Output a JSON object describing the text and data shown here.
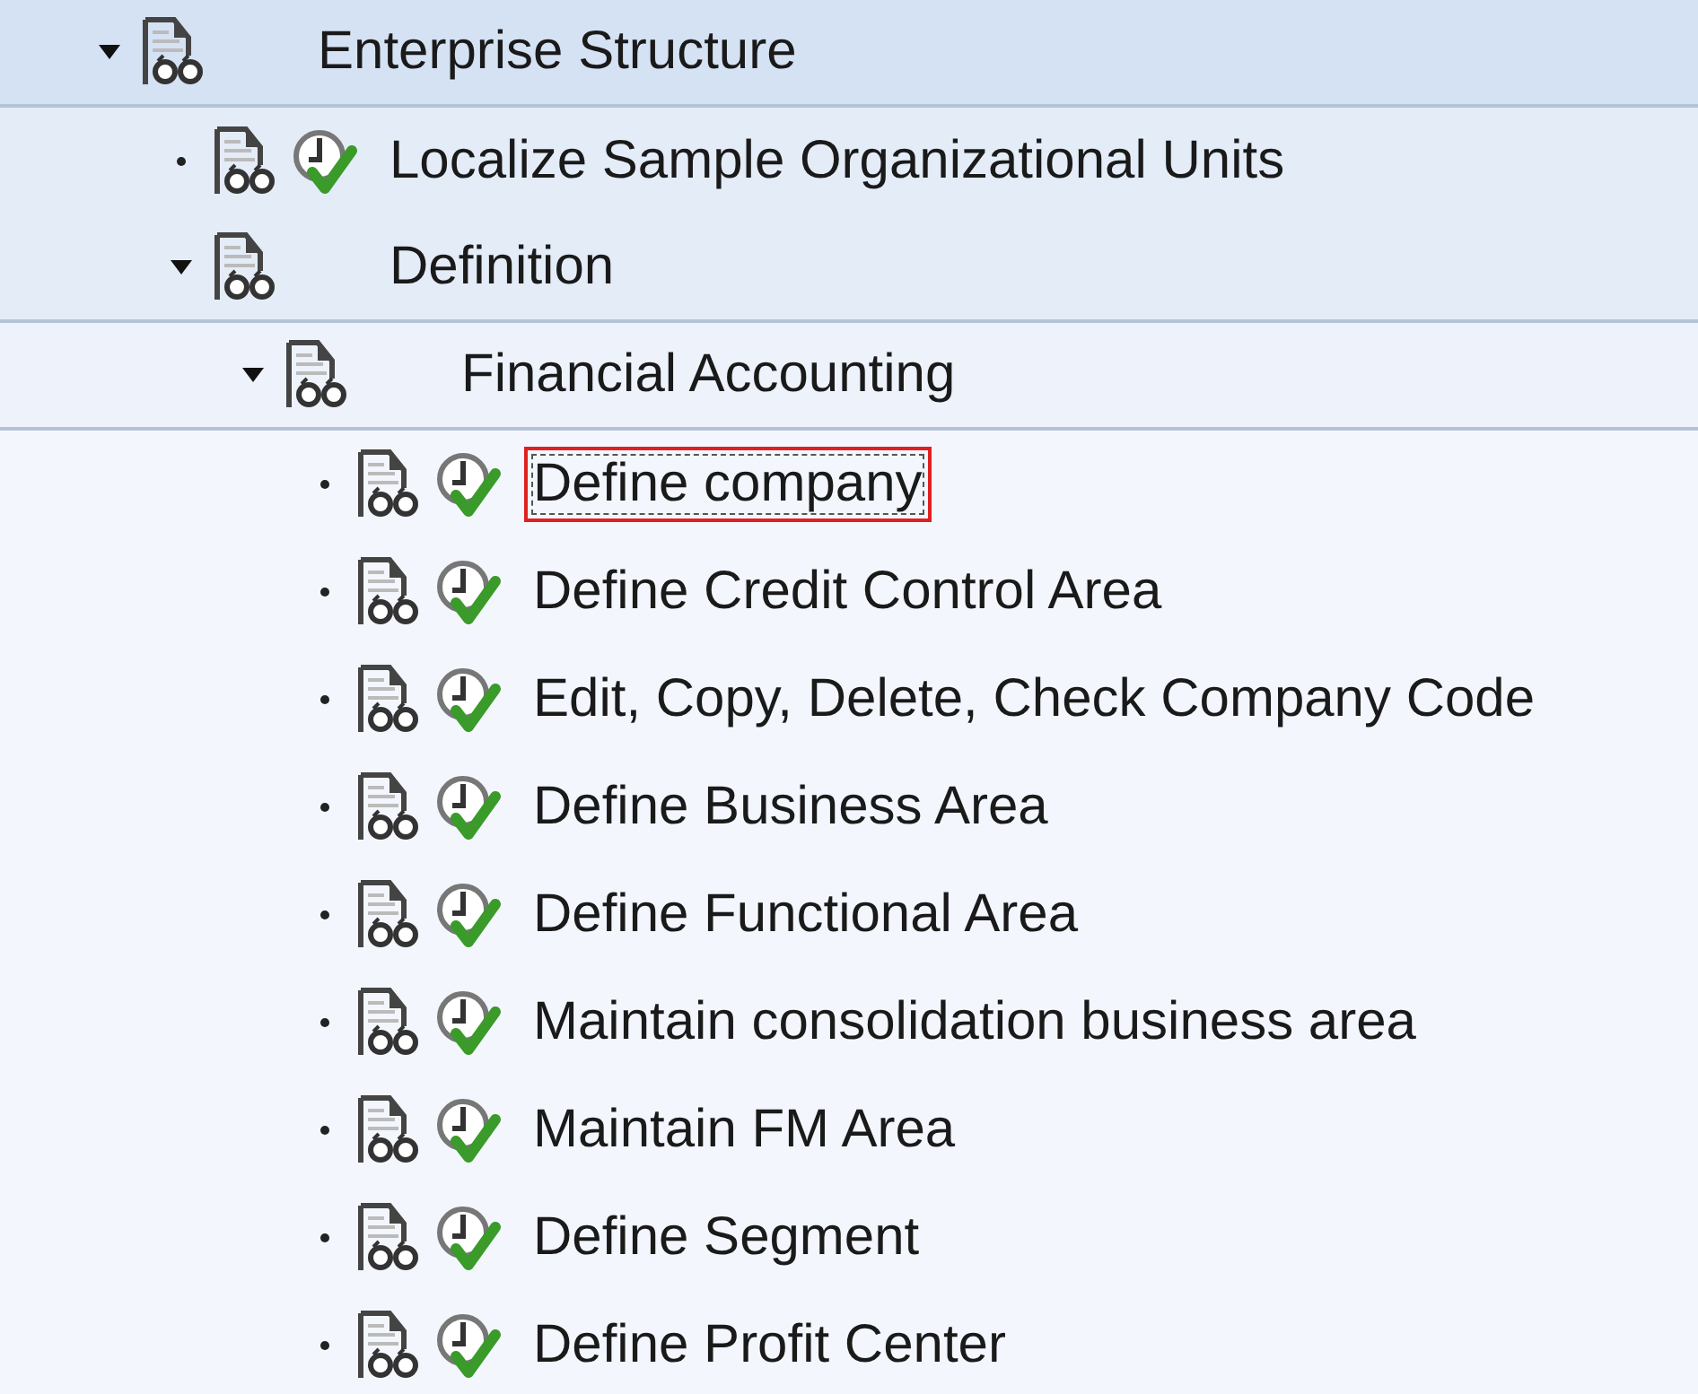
{
  "tree": [
    {
      "text": "Enterprise Structure",
      "expanded": true,
      "selected": false,
      "children": [
        {
          "text": "Localize Sample Organizational Units",
          "kind": "activity",
          "selected": false
        },
        {
          "text": "Definition",
          "expanded": true,
          "selected": false,
          "children": [
            {
              "text": "Financial Accounting",
              "expanded": true,
              "selected": false,
              "children": [
                {
                  "text": "Define company",
                  "kind": "activity",
                  "selected": true
                },
                {
                  "text": "Define Credit Control Area",
                  "kind": "activity",
                  "selected": false
                },
                {
                  "text": "Edit, Copy, Delete, Check Company Code",
                  "kind": "activity",
                  "selected": false
                },
                {
                  "text": "Define Business Area",
                  "kind": "activity",
                  "selected": false
                },
                {
                  "text": "Define Functional Area",
                  "kind": "activity",
                  "selected": false
                },
                {
                  "text": "Maintain consolidation business area",
                  "kind": "activity",
                  "selected": false
                },
                {
                  "text": "Maintain FM Area",
                  "kind": "activity",
                  "selected": false
                },
                {
                  "text": "Define Segment",
                  "kind": "activity",
                  "selected": false
                },
                {
                  "text": "Define Profit Center",
                  "kind": "activity",
                  "selected": false
                }
              ]
            }
          ]
        }
      ]
    }
  ]
}
